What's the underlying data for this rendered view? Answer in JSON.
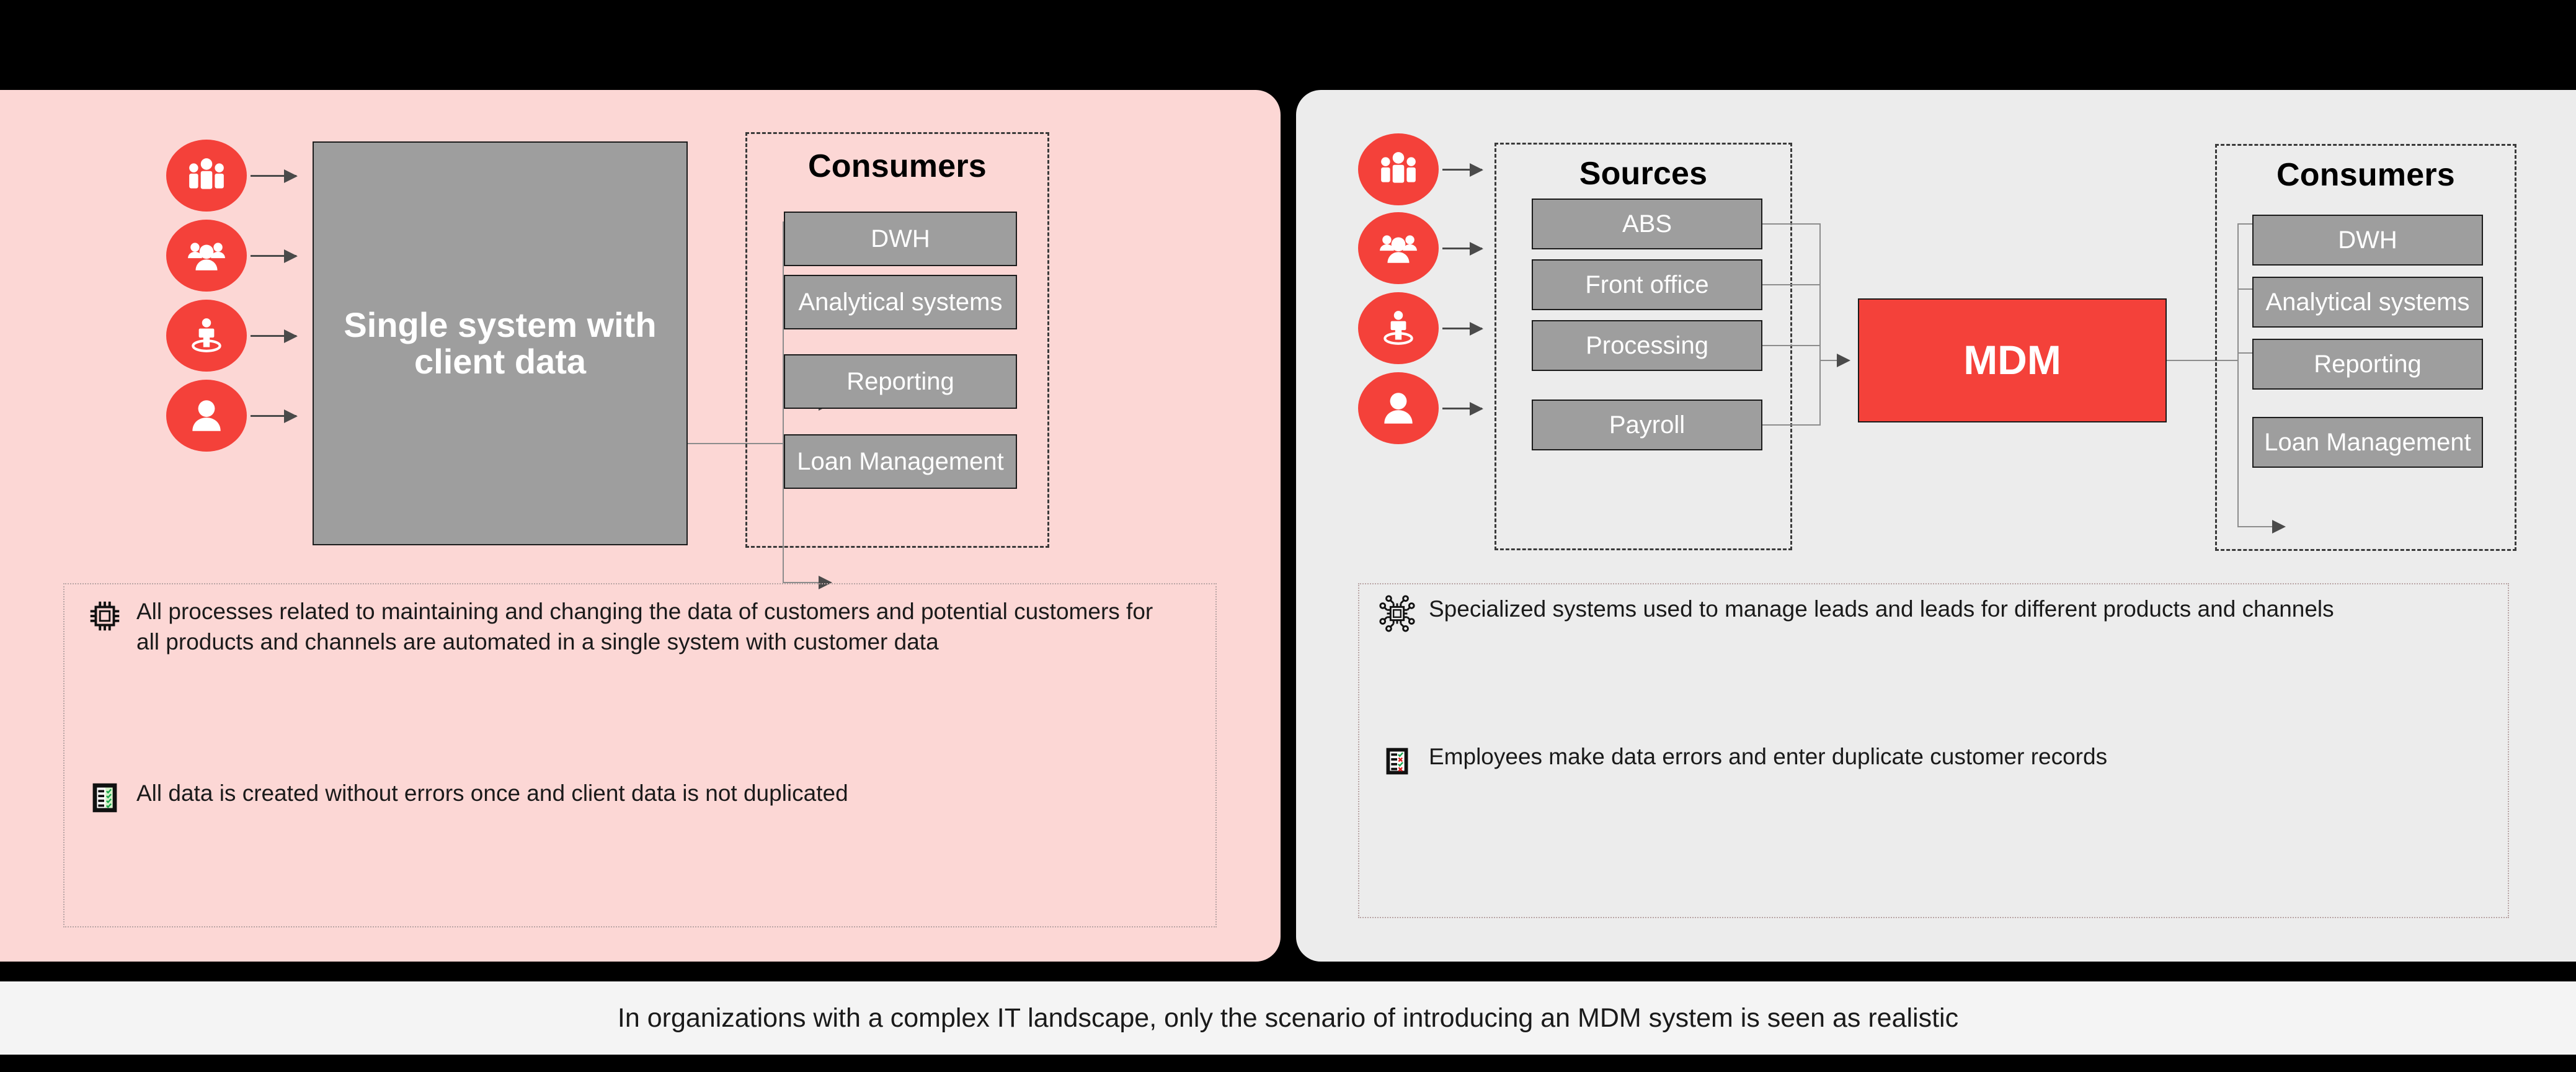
{
  "colors": {
    "accent_red": "#F4413A",
    "panel_left_bg": "#FCD7D5",
    "panel_right_bg": "#ECECEC",
    "box_grey": "#9E9E9E",
    "caption_bg": "#F4F4F4"
  },
  "left_panel": {
    "source_icons": [
      {
        "name": "group-of-three-people-icon"
      },
      {
        "name": "team-people-icon"
      },
      {
        "name": "person-in-spotlight-icon"
      },
      {
        "name": "single-person-icon"
      }
    ],
    "central_system": {
      "label": "Single system with client data"
    },
    "consumers": {
      "title": "Consumers",
      "items": [
        "DWH",
        "Analytical systems",
        "Reporting",
        "Loan Management"
      ]
    },
    "notes": [
      {
        "icon": "cpu-chip-icon",
        "text": "All processes related to maintaining and changing the data of customers and potential customers for all products and channels are automated in a single system with customer data"
      },
      {
        "icon": "checklist-all-ok-icon",
        "text": "All data is created without errors once and client data is not duplicated"
      }
    ]
  },
  "right_panel": {
    "source_icons": [
      {
        "name": "group-of-three-people-icon"
      },
      {
        "name": "team-people-icon"
      },
      {
        "name": "person-in-spotlight-icon"
      },
      {
        "name": "single-person-icon"
      }
    ],
    "sources": {
      "title": "Sources",
      "items": [
        "ABS",
        "Front office",
        "Processing",
        "Payroll"
      ]
    },
    "hub": {
      "label": "MDM"
    },
    "consumers": {
      "title": "Consumers",
      "items": [
        "DWH",
        "Analytical systems",
        "Reporting",
        "Loan Management"
      ]
    },
    "notes": [
      {
        "icon": "circuit-chip-icon",
        "text": "Specialized systems used to manage leads and leads for different products and channels"
      },
      {
        "icon": "checklist-mixed-icon",
        "text": "Employees make data errors and enter duplicate customer records"
      }
    ]
  },
  "caption": {
    "text": "In organizations with a complex IT landscape, only the scenario of introducing an MDM system is seen as realistic"
  }
}
